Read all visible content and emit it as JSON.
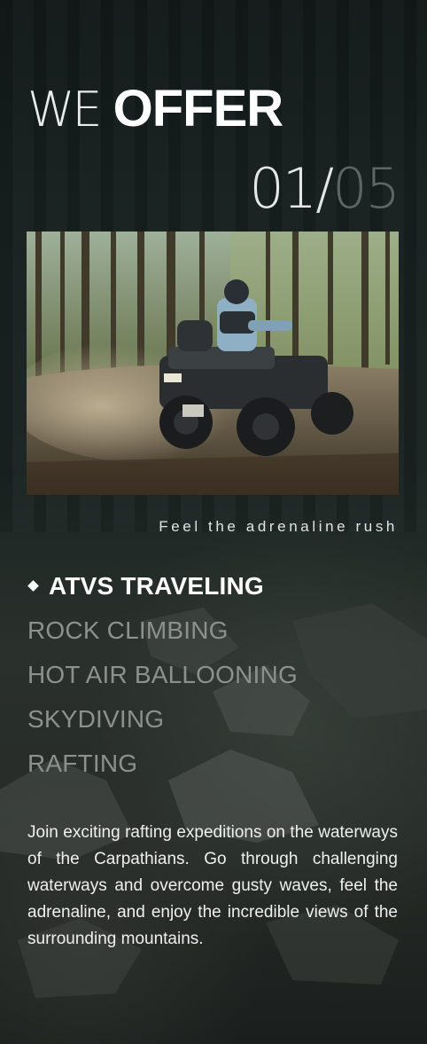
{
  "header": {
    "title_light": "WE",
    "title_bold": "OFFER"
  },
  "counter": {
    "current": "01/",
    "total": "05"
  },
  "slide": {
    "image_icon": "atv-photo",
    "caption": "Feel the adrenaline rush"
  },
  "menu": {
    "items": [
      {
        "label": "ATVS TRAVELING",
        "active": true
      },
      {
        "label": "ROCK CLIMBING",
        "active": false
      },
      {
        "label": "HOT AIR BALLOONING",
        "active": false
      },
      {
        "label": "SKYDIVING",
        "active": false
      },
      {
        "label": "RAFTING",
        "active": false
      }
    ]
  },
  "description": "Join exciting rafting expeditions on the waterways of the Carpathians. Go through challenging waterways and overcome gusty waves, feel the adrenaline, and enjoy the incredible views of the surrounding mountains.",
  "colors": {
    "background": "#1b2523",
    "active_text": "#ffffff",
    "inactive_text": "#8c918f",
    "counter_total": "#5d6664"
  }
}
